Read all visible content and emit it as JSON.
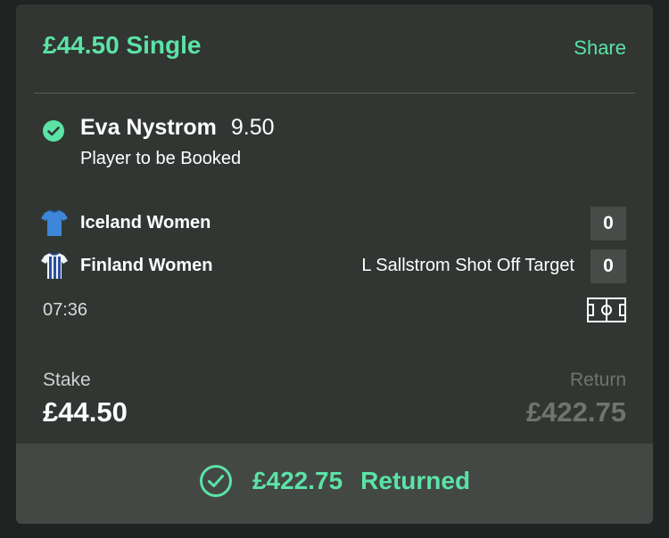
{
  "header": {
    "title": "£44.50 Single",
    "share_label": "Share"
  },
  "selection": {
    "name": "Eva Nystrom",
    "odds": "9.50",
    "market": "Player to be Booked",
    "status_icon": "check-circle-icon"
  },
  "match": {
    "teams": [
      {
        "name": "Iceland Women",
        "score": "0",
        "event": "",
        "shirt_icon": "shirt-blue-icon"
      },
      {
        "name": "Finland Women",
        "score": "0",
        "event": "L Sallstrom Shot Off Target",
        "shirt_icon": "shirt-white-blue-stripes-icon"
      }
    ],
    "clock": "07:36",
    "pitch_icon": "pitch-icon"
  },
  "stake": {
    "label": "Stake",
    "value": "£44.50"
  },
  "return": {
    "label": "Return",
    "value": "£422.75"
  },
  "footer": {
    "amount": "£422.75",
    "status": "Returned",
    "icon": "check-circle-outline-icon"
  },
  "colors": {
    "accent": "#5be3a6",
    "card_bg": "#313633",
    "footer_bg": "#434845",
    "page_bg": "#1f2321",
    "muted": "#6f7471"
  }
}
